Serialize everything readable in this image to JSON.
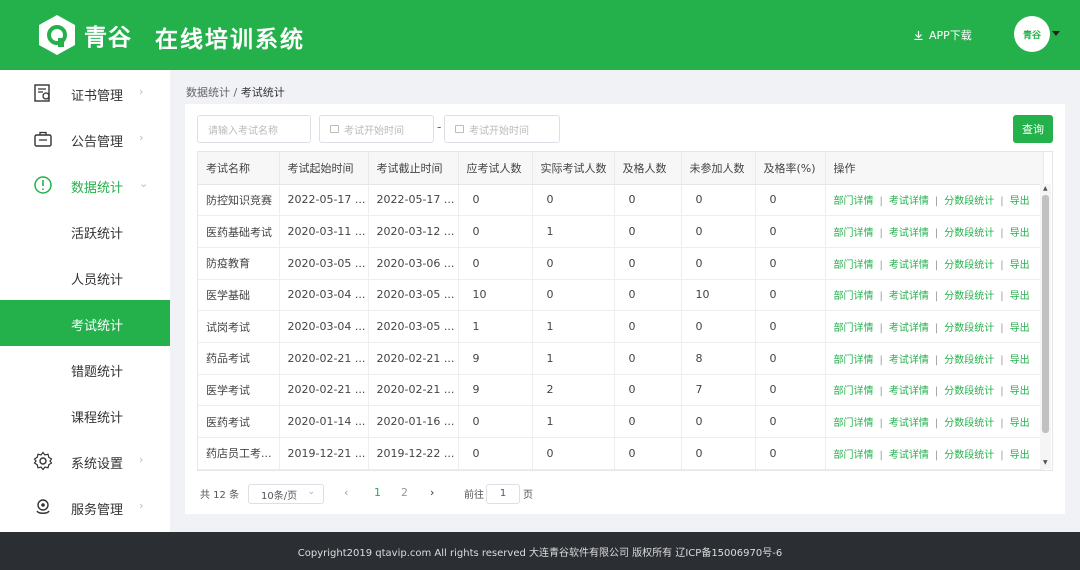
{
  "header": {
    "brand": "青谷",
    "system_title": "在线培训系统",
    "app_download": "APP下载",
    "avatar_text": "青谷"
  },
  "sidebar": {
    "items": [
      {
        "label": "证书管理",
        "icon": "certificate-icon"
      },
      {
        "label": "公告管理",
        "icon": "briefcase-icon"
      },
      {
        "label": "数据统计",
        "icon": "stats-icon"
      },
      {
        "label": "活跃统计"
      },
      {
        "label": "人员统计"
      },
      {
        "label": "考试统计"
      },
      {
        "label": "错题统计"
      },
      {
        "label": "课程统计"
      },
      {
        "label": "系统设置",
        "icon": "gear-icon"
      },
      {
        "label": "服务管理",
        "icon": "service-icon"
      }
    ]
  },
  "breadcrumb": {
    "parent": "数据统计",
    "separator": "/",
    "current": "考试统计"
  },
  "filters": {
    "exam_name_placeholder": "请输入考试名称",
    "start_placeholder": "考试开始时间",
    "end_placeholder": "考试开始时间",
    "range_sep": "-",
    "query_button": "查询"
  },
  "table": {
    "headers": [
      "考试名称",
      "考试起始时间",
      "考试截止时间",
      "应考试人数",
      "实际考试人数",
      "及格人数",
      "未参加人数",
      "及格率(%)",
      "操作"
    ],
    "rows": [
      [
        "防控知识竞赛",
        "2022-05-17 ...",
        "2022-05-17 ...",
        "0",
        "0",
        "0",
        "0",
        "0"
      ],
      [
        "医药基础考试",
        "2020-03-11 ...",
        "2020-03-12 ...",
        "0",
        "1",
        "0",
        "0",
        "0"
      ],
      [
        "防疫教育",
        "2020-03-05 ...",
        "2020-03-06 ...",
        "0",
        "0",
        "0",
        "0",
        "0"
      ],
      [
        "医学基础",
        "2020-03-04 ...",
        "2020-03-05 ...",
        "10",
        "0",
        "0",
        "10",
        "0"
      ],
      [
        "试岗考试",
        "2020-03-04 ...",
        "2020-03-05 ...",
        "1",
        "1",
        "0",
        "0",
        "0"
      ],
      [
        "药品考试",
        "2020-02-21 ...",
        "2020-02-21 ...",
        "9",
        "1",
        "0",
        "8",
        "0"
      ],
      [
        "医学考试",
        "2020-02-21 ...",
        "2020-02-21 ...",
        "9",
        "2",
        "0",
        "7",
        "0"
      ],
      [
        "医药考试",
        "2020-01-14 ...",
        "2020-01-16 ...",
        "0",
        "1",
        "0",
        "0",
        "0"
      ],
      [
        "药店员工考...",
        "2019-12-21 ...",
        "2019-12-22 ...",
        "0",
        "0",
        "0",
        "0",
        "0"
      ]
    ],
    "actions": [
      "部门详情",
      "考试详情",
      "分数段统计",
      "导出"
    ],
    "action_sep": "|"
  },
  "pagination": {
    "total": "共 12 条",
    "page_size": "10条/页",
    "prev": "‹",
    "next": "›",
    "pages": [
      "1",
      "2"
    ],
    "current_page": "1",
    "goto_label": "前往",
    "goto_value": "1",
    "page_unit": "页"
  },
  "footer": {
    "text": "Copyright2019 qtavip.com All rights reserved 大连青谷软件有限公司 版权所有 辽ICP备15006970号-6"
  },
  "colors": {
    "accent": "#24b14c",
    "footer_bg": "#2b2e33"
  }
}
